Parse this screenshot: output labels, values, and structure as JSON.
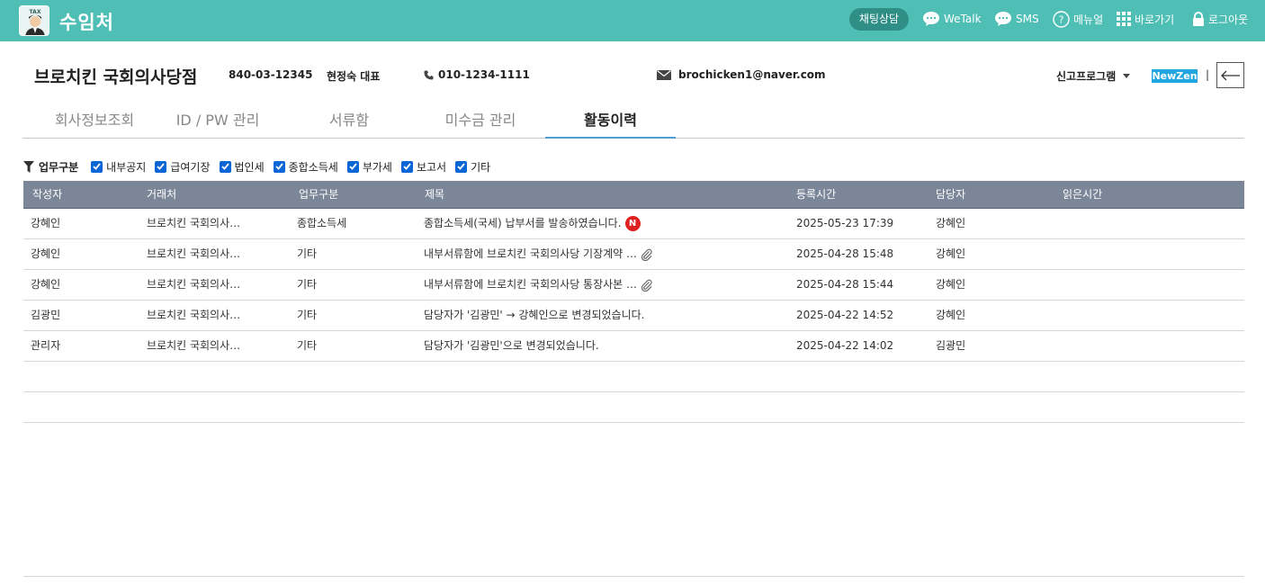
{
  "header": {
    "app_title": "수임처",
    "logo_text": "TAX",
    "chat_button": "채팅상담",
    "wetalk": "WeTalk",
    "sms": "SMS",
    "manual": "메뉴얼",
    "shortcut": "바로가기",
    "logout": "로그아웃"
  },
  "company": {
    "name": "브로치킨 국회의사당점",
    "biz_no": "840-03-12345",
    "representative": "현정숙 대표",
    "phone": "010-1234-1111",
    "email": "brochicken1@naver.com",
    "program_select": "신고프로그램",
    "newzen": "NewZen",
    "separator": "|"
  },
  "tabs": [
    {
      "label": "회사정보조회",
      "active": false
    },
    {
      "label": "ID / PW 관리",
      "active": false
    },
    {
      "label": "서류함",
      "active": false
    },
    {
      "label": "미수금 관리",
      "active": false
    },
    {
      "label": "활동이력",
      "active": true
    }
  ],
  "filter": {
    "label": "업무구분",
    "options": [
      {
        "label": "내부공지",
        "checked": true
      },
      {
        "label": "급여기장",
        "checked": true
      },
      {
        "label": "법인세",
        "checked": true
      },
      {
        "label": "종합소득세",
        "checked": true
      },
      {
        "label": "부가세",
        "checked": true
      },
      {
        "label": "보고서",
        "checked": true
      },
      {
        "label": "기타",
        "checked": true
      }
    ]
  },
  "table": {
    "columns": [
      "작성자",
      "거래처",
      "업무구분",
      "제목",
      "등록시간",
      "담당자",
      "읽은시간"
    ],
    "rows": [
      {
        "author": "강혜인",
        "client": "브로치킨 국회의사…",
        "category": "종합소득세",
        "title": "종합소득세(국세) 납부서를 발송하였습니다.",
        "time": "2025-05-23 17:39",
        "manager": "강혜인",
        "read": "",
        "badge": "N",
        "attachment": false
      },
      {
        "author": "강혜인",
        "client": "브로치킨 국회의사…",
        "category": "기타",
        "title": "내부서류함에 브로치킨 국회의사당 기장계약 …",
        "time": "2025-04-28 15:48",
        "manager": "강혜인",
        "read": "",
        "badge": "",
        "attachment": true
      },
      {
        "author": "강혜인",
        "client": "브로치킨 국회의사…",
        "category": "기타",
        "title": "내부서류함에 브로치킨 국회의사당 통장사본 …",
        "time": "2025-04-28 15:44",
        "manager": "강혜인",
        "read": "",
        "badge": "",
        "attachment": true
      },
      {
        "author": "김광민",
        "client": "브로치킨 국회의사…",
        "category": "기타",
        "title": "담당자가 '김광민' → 강혜인으로 변경되었습니다.",
        "time": "2025-04-22 14:52",
        "manager": "강혜인",
        "read": "",
        "badge": "",
        "attachment": false
      },
      {
        "author": "관리자",
        "client": "브로치킨 국회의사…",
        "category": "기타",
        "title": "담당자가 '김광민'으로 변경되었습니다.",
        "time": "2025-04-22 14:02",
        "manager": "김광민",
        "read": "",
        "badge": "",
        "attachment": false
      }
    ]
  },
  "icons": {
    "wetalk": "chat-bubble-icon",
    "sms": "sms-bubble-icon",
    "manual": "question-circle-icon",
    "shortcut": "grid-icon",
    "logout": "lock-icon",
    "phone": "phone-icon",
    "email": "envelope-icon",
    "back": "arrow-left-icon",
    "filter": "funnel-icon",
    "attachment": "paperclip-icon"
  },
  "colors": {
    "topbar": "#4fbfb6",
    "chat_button": "#2f8f87",
    "table_header": "#7b8698",
    "active_tab_line": "#4aa0d6",
    "newzen": "#22a6e0",
    "new_badge": "#e02020",
    "checkbox": "#0a66d6"
  }
}
